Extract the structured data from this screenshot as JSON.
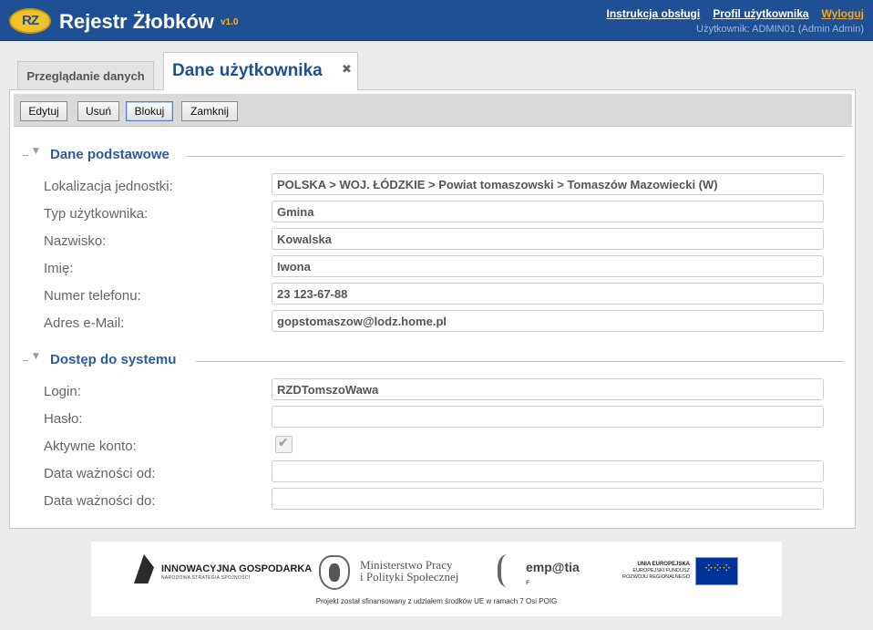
{
  "header": {
    "logo_text": "RZ",
    "title": "Rejestr Żłobków",
    "version": "v1.0",
    "links": {
      "manual": "Instrukcja obsługi",
      "profile": "Profil użytkownika",
      "logout": "Wyloguj"
    },
    "user_info": "Użytkownik: ADMIN01 (Admin Admin)"
  },
  "tabs": {
    "browse": "Przeglądanie danych",
    "user_data": "Dane użytkownika",
    "close_glyph": "✖"
  },
  "toolbar": {
    "edit": "Edytuj",
    "delete": "Usuń",
    "block": "Blokuj",
    "close": "Zamknij"
  },
  "sections": {
    "basic": {
      "title": "Dane podstawowe",
      "fields": {
        "location": {
          "label": "Lokalizacja jednostki:",
          "value": "POLSKA > WOJ. ŁÓDZKIE > Powiat tomaszowski > Tomaszów Mazowiecki (W)"
        },
        "user_type": {
          "label": "Typ użytkownika:",
          "value": "Gmina"
        },
        "surname": {
          "label": "Nazwisko:",
          "value": "Kowalska"
        },
        "name": {
          "label": "Imię:",
          "value": "Iwona"
        },
        "phone": {
          "label": "Numer telefonu:",
          "value": "23 123-67-88"
        },
        "email": {
          "label": "Adres e-Mail:",
          "value": "gopstomaszow@lodz.home.pl"
        }
      }
    },
    "access": {
      "title": "Dostęp do systemu",
      "fields": {
        "login": {
          "label": "Login:",
          "value": "RZDTomszoWawa"
        },
        "password": {
          "label": "Hasło:",
          "value": ""
        },
        "active": {
          "label": "Aktywne konto:",
          "checked": true,
          "check_glyph": "✔"
        },
        "valid_from": {
          "label": "Data ważności od:",
          "value": ""
        },
        "valid_to": {
          "label": "Data ważności do:",
          "value": ""
        }
      }
    }
  },
  "footer": {
    "ig_title": "INNOWACYJNA GOSPODARKA",
    "ig_subtitle": "NARODOWA STRATEGIA SPÓJNOŚCI",
    "ministry_line1": "Ministerstwo Pracy",
    "ministry_line2": "i Polityki Społecznej",
    "empatia": "emp@tia",
    "empatia_mark": "ꜰ",
    "eu_line1": "UNIA EUROPEJSKA",
    "eu_line2": "EUROPEJSKI FUNDUSZ",
    "eu_line3": "ROZWOJU REGIONALNEGO",
    "eu_stars": "⁘⁘⁘",
    "note": "Projekt został sfinansowany z udziałem środków UE w ramach 7 Osi POIG"
  }
}
